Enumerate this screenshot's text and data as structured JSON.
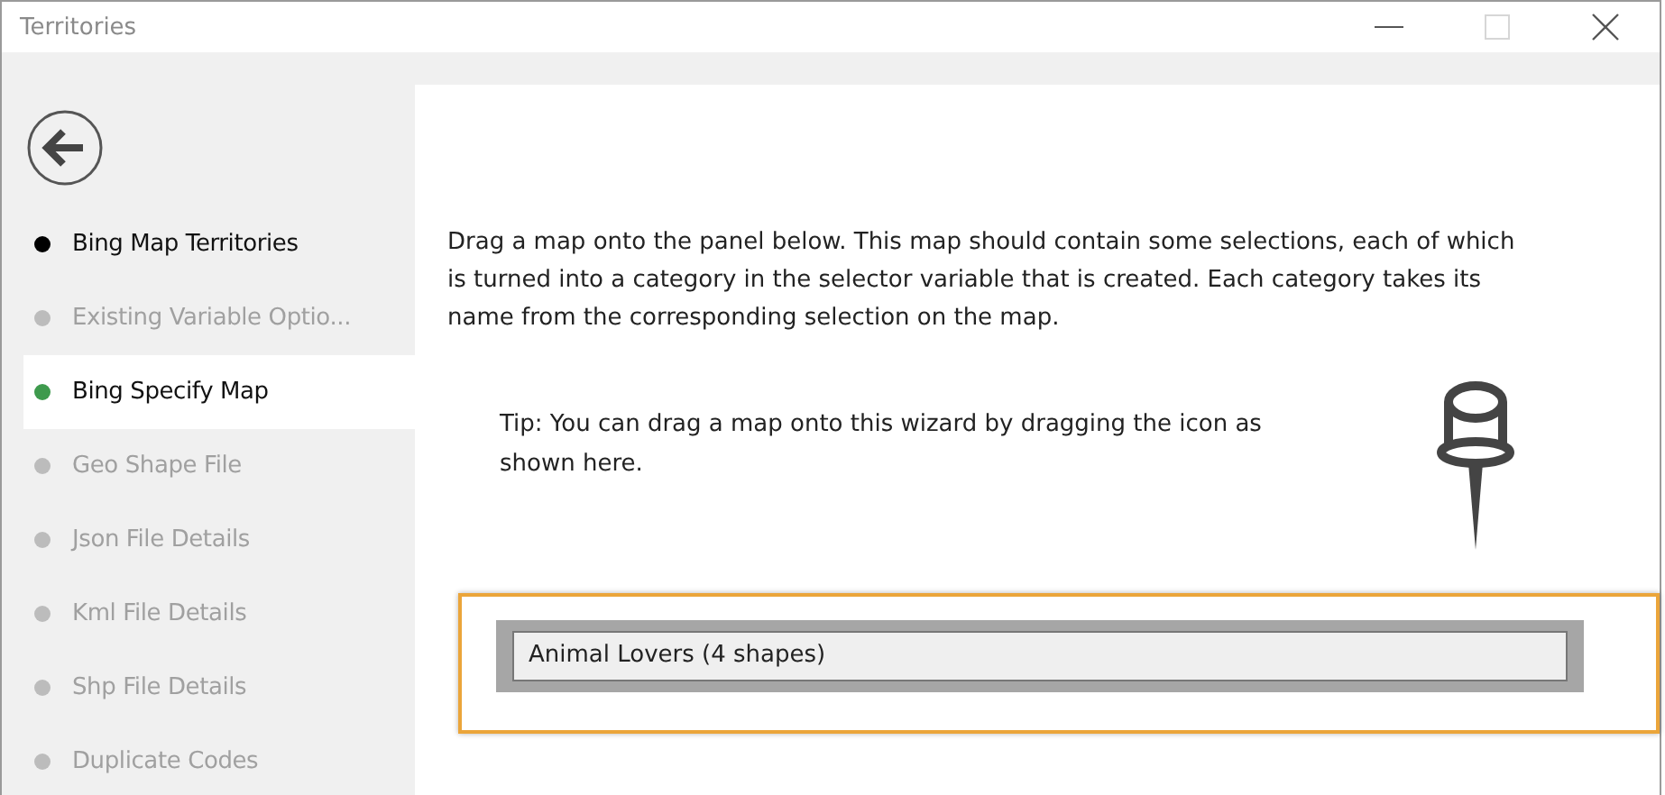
{
  "window": {
    "title": "Territories",
    "maximize_disabled": true
  },
  "sidebar": {
    "steps": [
      {
        "label": "Bing Map Territories",
        "color": "#000000",
        "disabled": false,
        "selected": false
      },
      {
        "label": "Existing Variable Optio...",
        "color": "#bcbcbc",
        "disabled": true,
        "selected": false
      },
      {
        "label": "Bing Specify Map",
        "color": "#3e9a4d",
        "disabled": false,
        "selected": true
      },
      {
        "label": "Geo Shape File",
        "color": "#bcbcbc",
        "disabled": true,
        "selected": false
      },
      {
        "label": "Json File Details",
        "color": "#bcbcbc",
        "disabled": true,
        "selected": false
      },
      {
        "label": "Kml File Details",
        "color": "#bcbcbc",
        "disabled": true,
        "selected": false
      },
      {
        "label": "Shp File Details",
        "color": "#bcbcbc",
        "disabled": true,
        "selected": false
      },
      {
        "label": "Duplicate Codes",
        "color": "#bcbcbc",
        "disabled": true,
        "selected": false
      }
    ]
  },
  "content": {
    "description": "Drag a map onto the panel below. This map should contain some selections, each of which is turned into a category in the selector variable that is created. Each category takes its name from the corresponding selection on the map.",
    "tip": "Tip: You can drag a map onto this wizard by dragging the icon as shown here.",
    "drop_zone": {
      "value": "Animal Lovers (4 shapes)",
      "highlighted": true
    }
  }
}
